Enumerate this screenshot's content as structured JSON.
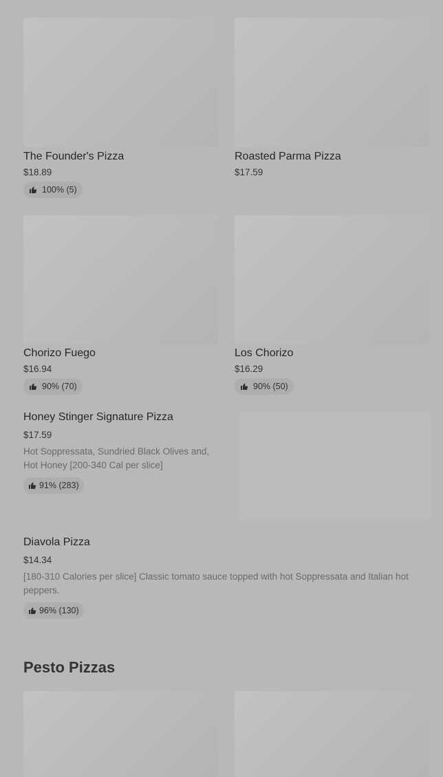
{
  "items": [
    {
      "name": "The Founder's Pizza",
      "price": "$18.89",
      "rating": "100% (5)"
    },
    {
      "name": "Roasted Parma Pizza",
      "price": "$17.59"
    },
    {
      "name": "Chorizo Fuego",
      "price": "$16.94",
      "rating": "90% (70)"
    },
    {
      "name": "Los Chorizo",
      "price": "$16.29",
      "rating": "90% (50)"
    },
    {
      "name": "Honey Stinger Signature Pizza",
      "price": "$17.59",
      "description": "Hot Soppressata, Sundried Black Olives and, Hot Honey [200-340 Cal per slice]",
      "rating": "91% (283)"
    },
    {
      "name": "Diavola Pizza",
      "price": "$14.34",
      "description": "[180-310 Calories per slice] Classic tomato sauce topped with hot Soppressata and Italian hot peppers.",
      "rating": "96% (130)"
    }
  ],
  "sections": {
    "pesto_title": "Pesto Pizzas"
  },
  "icons": {
    "rating": "thumbs-up-icon"
  }
}
